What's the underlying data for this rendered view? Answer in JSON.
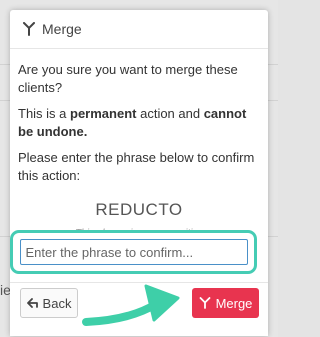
{
  "dialog": {
    "title": "Merge",
    "question": "Are you sure you want to merge these clients?",
    "permanent_prefix": "This is a ",
    "permanent_bold": "permanent",
    "permanent_mid": " action and ",
    "permanent_bold2": "cannot be undone.",
    "instruction": "Please enter the phrase below to confirm this action:",
    "phrase": "REDUCTO",
    "hint": "This phrase is case sensitive",
    "input_placeholder": "Enter the phrase to confirm...",
    "back_label": "Back",
    "merge_label": "Merge"
  },
  "background": {
    "fragments": [
      "ie"
    ]
  },
  "colors": {
    "merge_button": "#e8344f",
    "highlight": "#45ccb4"
  }
}
